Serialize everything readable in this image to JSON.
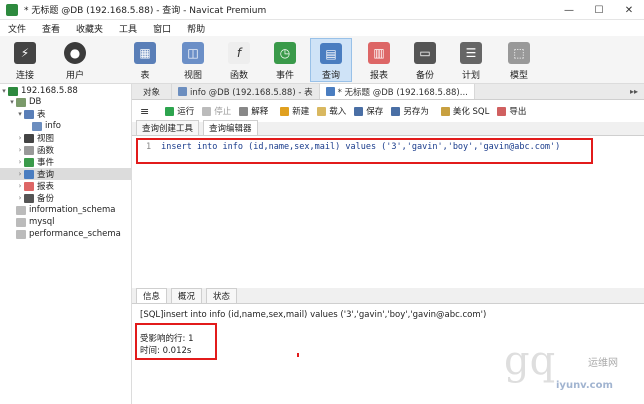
{
  "window": {
    "title": "* 无标题 @DB (192.168.5.88) - 查询 - Navicat Premium",
    "controls": [
      "—",
      "☐",
      "✕"
    ]
  },
  "menu": [
    "文件",
    "查看",
    "收藏夹",
    "工具",
    "窗口",
    "帮助"
  ],
  "toolbar": {
    "connect": "连接",
    "user": "用户",
    "table": "表",
    "view": "视图",
    "function": "函数",
    "event": "事件",
    "query": "查询",
    "report": "报表",
    "backup": "备份",
    "schedule": "计划",
    "model": "模型"
  },
  "sidebar": {
    "connection": "192.168.5.88",
    "db": "DB",
    "tables": "表",
    "table_info": "info",
    "views": "视图",
    "functions": "函数",
    "events": "事件",
    "queries": "查询",
    "reports": "报表",
    "backups": "备份",
    "db2": "information_schema",
    "db3": "mysql",
    "db4": "performance_schema"
  },
  "tabs": {
    "objects": "对象",
    "info_tab": "info @DB (192.168.5.88) - 表",
    "query_tab": "* 无标题 @DB (192.168.5.88)...",
    "more": "▸▸"
  },
  "editor_toolbar": {
    "run": "运行",
    "stop": "停止",
    "explain": "解释",
    "new": "新建",
    "load": "载入",
    "save": "保存",
    "save_as": "另存为",
    "beautify": "美化 SQL",
    "export": "导出"
  },
  "subtabs": {
    "builder": "查询创建工具",
    "editor": "查询编辑器"
  },
  "editor": {
    "line_no": "1",
    "sql": "insert into info (id,name,sex,mail) values ('3','gavin','boy','gavin@abc.com')"
  },
  "result_tabs": {
    "info": "信息",
    "profile": "概况",
    "status": "状态"
  },
  "result": {
    "sql_line": "[SQL]insert into info (id,name,sex,mail) values ('3','gavin','boy','gavin@abc.com')",
    "affected": "受影响的行: 1",
    "time": "时间: 0.012s"
  },
  "watermark": {
    "big": "gq",
    "cn": "运维网",
    "en": "iyunv.com"
  },
  "colors": {
    "highlight_box": "#e21b1b",
    "active_tool": "#cfe3f7",
    "sql_text": "#1a3c8c"
  }
}
